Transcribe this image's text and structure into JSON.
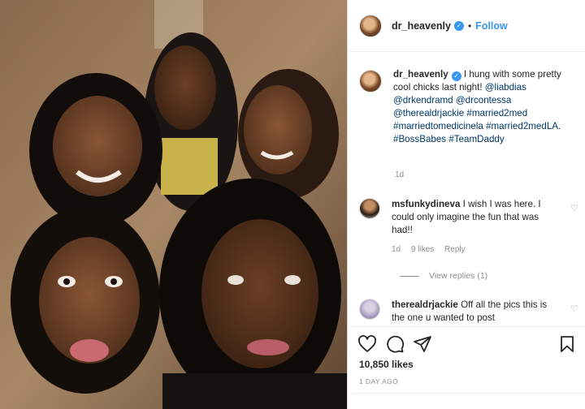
{
  "post": {
    "username": "dr_heavenly",
    "verified_mark": "✓",
    "separator": "•",
    "follow_label": "Follow",
    "caption": {
      "username": "dr_heavenly",
      "segments": [
        {
          "text": " I hung with some pretty cool chicks last night! ",
          "type": "text"
        },
        {
          "text": "@liabdias",
          "type": "tag"
        },
        {
          "text": " ",
          "type": "text"
        },
        {
          "text": "@drkendramd",
          "type": "tag"
        },
        {
          "text": " ",
          "type": "text"
        },
        {
          "text": "@drcontessa",
          "type": "tag"
        },
        {
          "text": " ",
          "type": "text"
        },
        {
          "text": "@therealdrjackie",
          "type": "tag"
        },
        {
          "text": " ",
          "type": "text"
        },
        {
          "text": "#married2med",
          "type": "tag"
        },
        {
          "text": " ",
          "type": "text"
        },
        {
          "text": "#marriedtomedicinela",
          "type": "tag"
        },
        {
          "text": " ",
          "type": "text"
        },
        {
          "text": "#married2medLA",
          "type": "tag"
        },
        {
          "text": ". ",
          "type": "text"
        },
        {
          "text": "#BossBabes",
          "type": "tag"
        },
        {
          "text": " ",
          "type": "text"
        },
        {
          "text": "#TeamDaddy",
          "type": "tag"
        }
      ],
      "time": "1d"
    },
    "comments": [
      {
        "username": "msfunkydineva",
        "text": " I wish I was here. I could only imagine the fun that was had!!",
        "time": "1d",
        "likes": "9 likes",
        "reply": "Reply",
        "view_replies": "View replies (1)"
      },
      {
        "username": "therealdrjackie",
        "text": " Off all the pics this is the one u wanted to post"
      }
    ],
    "likes": "10,850 likes",
    "time_ago": "1 DAY AGO"
  },
  "icons": {
    "heart": "heart-icon",
    "comment": "comment-icon",
    "share": "share-icon",
    "save": "bookmark-icon",
    "small_heart": "♡"
  },
  "colors": {
    "link": "#3897f0",
    "tag": "#00376b",
    "muted": "#8e8e8e"
  }
}
